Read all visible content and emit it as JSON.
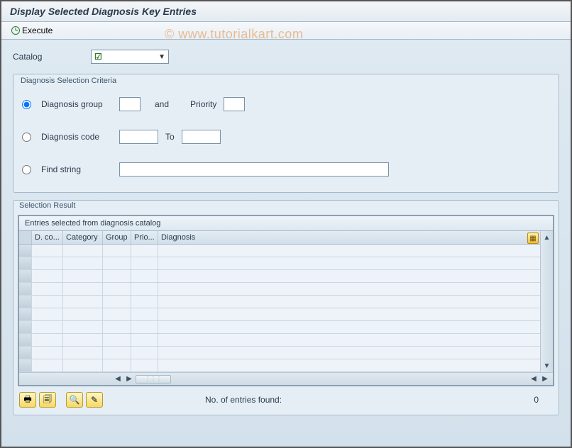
{
  "title": "Display Selected Diagnosis Key Entries",
  "watermark": "© www.tutorialkart.com",
  "toolbar": {
    "execute_label": "Execute"
  },
  "catalog": {
    "label": "Catalog",
    "value": "",
    "tick_indicator": "☑"
  },
  "criteria": {
    "title": "Diagnosis Selection Criteria",
    "options": {
      "group": {
        "label": "Diagnosis group",
        "and_label": "and",
        "priority_label": "Priority",
        "group_value": "",
        "priority_value": ""
      },
      "code": {
        "label": "Diagnosis code",
        "to_label": "To",
        "from_value": "",
        "to_value": ""
      },
      "find": {
        "label": "Find string",
        "value": ""
      }
    },
    "selected": "group"
  },
  "result": {
    "title": "Selection Result",
    "grid_caption": "Entries selected from diagnosis catalog",
    "columns": {
      "c1": "D. co...",
      "c2": "Category",
      "c3": "Group",
      "c4": "Prio...",
      "c5": "Diagnosis"
    },
    "rows": 10,
    "footer_label": "No. of entries found:",
    "footer_value": "0"
  },
  "footer_icons": {
    "print": "print-icon",
    "output": "output-icon",
    "find": "search-icon",
    "edit": "edit-icon"
  }
}
